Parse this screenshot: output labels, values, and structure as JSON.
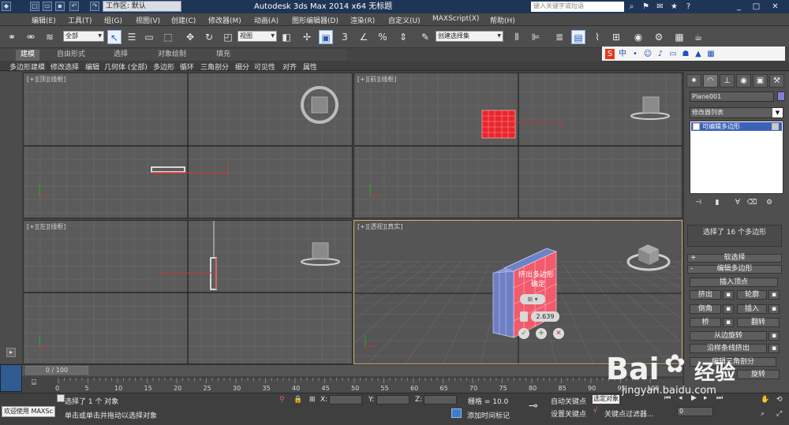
{
  "titlebar": {
    "workspace": "工作区: 默认",
    "app_title": "Autodesk 3ds Max  2014 x64      无标题",
    "search_placeholder": "键入关键字或短语"
  },
  "menu": [
    "编辑(E)",
    "工具(T)",
    "组(G)",
    "视图(V)",
    "创建(C)",
    "修改器(M)",
    "动画(A)",
    "图形编辑器(D)",
    "渲染(R)",
    "自定义(U)",
    "MAXScript(X)",
    "帮助(H)"
  ],
  "toolbar": {
    "filter": "全部",
    "refcoord": "视图",
    "named_sel": "创建选择集",
    "snap_num": "3"
  },
  "ribbon_tabs": [
    "建模",
    "自由形式",
    "选择",
    "对象绘制",
    "填充"
  ],
  "ribbon_items": [
    "多边形建模",
    "修改选择",
    "编辑",
    "几何体 (全部)",
    "多边形",
    "循环",
    "三角剖分",
    "细分",
    "可见性",
    "对齐",
    "属性"
  ],
  "viewports": {
    "top": "[+][顶][线框]",
    "front": "[+][前][线框]",
    "left": "[+][左][线框]",
    "persp": "[+][透视][真实]"
  },
  "caddy": {
    "title": "挤出多边形",
    "subtitle": "确定",
    "value": "2.639"
  },
  "panel": {
    "object_name": "Plane001",
    "modifier_list": "修改器列表",
    "stack_item": "可编辑多边形",
    "selection_info": "选择了 16 个多边形",
    "soft_sel": "软选择",
    "edit_poly": "编辑多边形",
    "insert_vertex": "插入顶点",
    "extrude": "挤出",
    "outline": "轮廓",
    "bevel": "倒角",
    "inset": "插入",
    "bridge": "桥",
    "flip": "翻转",
    "hinge": "从边旋转",
    "extrude_spline": "沿样条线挤出",
    "edit_tri": "编辑三角剖分",
    "turn": "旋转",
    "object_color": "#8080d8"
  },
  "timeline": {
    "frame": "0 / 100",
    "ticks": [
      "0",
      "5",
      "10",
      "15",
      "20",
      "25",
      "30",
      "35",
      "40",
      "45",
      "50",
      "55",
      "60",
      "65",
      "70",
      "75",
      "80",
      "85",
      "90",
      "95",
      "100"
    ]
  },
  "status": {
    "selected": "选择了 1 个 对象",
    "hint": "单击或单击并拖动以选择对象",
    "welcome": "欢迎使用 MAXSc",
    "x_label": "X:",
    "y_label": "Y:",
    "z_label": "Z:",
    "grid": "栅格 = 10.0",
    "add_tag": "添加时间标记",
    "autokey": "自动关键点",
    "setkey": "设置关键点",
    "selected_key": "选定对象",
    "key_filter": "关键点过滤器...",
    "frame_value": "0"
  },
  "watermark": {
    "brand": "Bai",
    "brand2": "经验",
    "url": "jingyan.baidu.com"
  }
}
